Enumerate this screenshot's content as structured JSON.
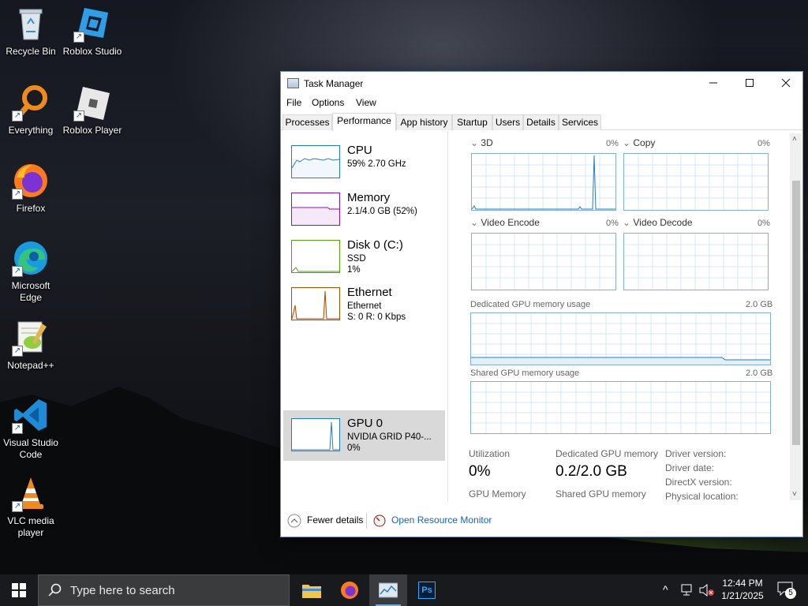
{
  "desktop": {
    "icons": [
      {
        "label": "Recycle Bin"
      },
      {
        "label": "Roblox Studio"
      },
      {
        "label": "Everything"
      },
      {
        "label": "Roblox Player"
      },
      {
        "label": "Firefox"
      },
      {
        "label": "Microsoft Edge"
      },
      {
        "label": "Notepad++"
      },
      {
        "label": "Visual Studio Code"
      },
      {
        "label": "VLC media player"
      }
    ]
  },
  "task_manager": {
    "title": "Task Manager",
    "menu": [
      "File",
      "Options",
      "View"
    ],
    "tabs": [
      "Processes",
      "Performance",
      "App history",
      "Startup",
      "Users",
      "Details",
      "Services"
    ],
    "active_tab": "Performance",
    "resources": [
      {
        "name": "CPU",
        "line1": "59%  2.70 GHz",
        "line2": "",
        "color": "#1f7fc4"
      },
      {
        "name": "Memory",
        "line1": "2.1/4.0 GB (52%)",
        "line2": "",
        "color": "#8b12ae"
      },
      {
        "name": "Disk 0 (C:)",
        "line1": "SSD",
        "line2": "1%",
        "color": "#4da60c"
      },
      {
        "name": "Ethernet",
        "line1": "Ethernet",
        "line2": "S: 0  R: 0 Kbps",
        "color": "#a74f01"
      },
      {
        "name": "GPU 0",
        "line1": "NVIDIA GRID P40-...",
        "line2": "0%",
        "color": "#1f7fc4"
      }
    ],
    "gpu": {
      "engines": [
        {
          "name": "3D",
          "pct": "0%"
        },
        {
          "name": "Copy",
          "pct": "0%"
        },
        {
          "name": "Video Encode",
          "pct": "0%"
        },
        {
          "name": "Video Decode",
          "pct": "0%"
        }
      ],
      "dedicated_label": "Dedicated GPU memory usage",
      "dedicated_max": "2.0 GB",
      "shared_label": "Shared GPU memory usage",
      "shared_max": "2.0 GB",
      "utilization_label": "Utilization",
      "utilization_value": "0%",
      "dedicated_mem_label": "Dedicated GPU memory",
      "dedicated_mem_value": "0.2/2.0 GB",
      "gpu_memory_label": "GPU Memory",
      "shared_mem_label": "Shared GPU memory",
      "driver_version_label": "Driver version:",
      "driver_date_label": "Driver date:",
      "directx_label": "DirectX version:",
      "physical_location_label": "Physical location:"
    },
    "footer": {
      "fewer_details": "Fewer details",
      "open_resource_monitor": "Open Resource Monitor"
    }
  },
  "taskbar": {
    "search_placeholder": "Type here to search",
    "time": "12:44 PM",
    "date": "1/21/2025",
    "notification_count": "5"
  }
}
